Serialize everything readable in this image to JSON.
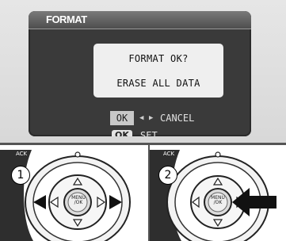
{
  "dialog": {
    "title": "FORMAT",
    "question": "FORMAT OK?",
    "warning": "ERASE ALL DATA",
    "ok_choice": "OK",
    "cancel_choice": "CANCEL",
    "ok_key": "OK",
    "set_label": "SET"
  },
  "steps": [
    {
      "number": "1",
      "menu_label": "MENU\n/OK",
      "side_label": "ACK"
    },
    {
      "number": "2",
      "menu_label": "MENU\n/OK",
      "side_label": "ACK"
    }
  ],
  "colors": {
    "screen_bg": "#3a3a3a",
    "message_box_bg": "#efefef",
    "highlight": "#c8c8c8"
  }
}
